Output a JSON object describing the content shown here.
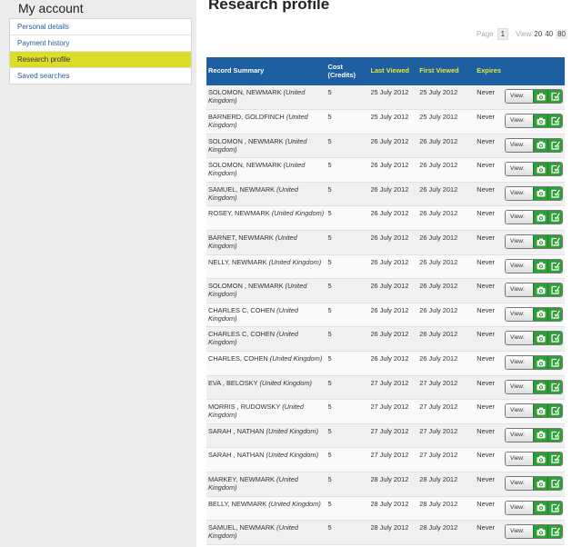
{
  "sidebar": {
    "title": "My account",
    "items": [
      {
        "label": "Personal details",
        "active": false
      },
      {
        "label": "Payment history",
        "active": false
      },
      {
        "label": "Research profile",
        "active": true
      },
      {
        "label": "Saved searches",
        "active": false
      }
    ]
  },
  "main": {
    "title": "Research profile",
    "pager": {
      "page_label": "Page",
      "page": "1",
      "view_label": "View",
      "sizes": [
        "20",
        "40",
        "80"
      ],
      "current_size": "80"
    },
    "columns": {
      "record": "Record Summary",
      "cost": "Cost (Credits)",
      "last_viewed": "Last Viewed",
      "first_viewed": "First Viewed",
      "expires": "Expires"
    },
    "view_label": "View:",
    "rows": [
      {
        "name": "SOLOMON, NEWMARK",
        "place": "(United Kingdom)",
        "cost": "5",
        "last": "25 July 2012",
        "first": "25 July 2012",
        "expires": "Never"
      },
      {
        "name": "BARNERD, GOLDFINCH",
        "place": "(United Kingdom)",
        "cost": "5",
        "last": "25 July 2012",
        "first": "25 July 2012",
        "expires": "Never"
      },
      {
        "name": "SOLOMON , NEWMARK",
        "place": "(United Kingdom)",
        "cost": "5",
        "last": "26 July 2012",
        "first": "26 July 2012",
        "expires": "Never"
      },
      {
        "name": "SOLOMON, NEWMARK",
        "place": "(United Kingdom)",
        "cost": "5",
        "last": "26 July 2012",
        "first": "26 July 2012",
        "expires": "Never"
      },
      {
        "name": "SAMUEL, NEWMARK",
        "place": "(United Kingdom)",
        "cost": "5",
        "last": "26 July 2012",
        "first": "26 July 2012",
        "expires": "Never"
      },
      {
        "name": "ROSEY, NEWMARK",
        "place": "(United Kingdom)",
        "cost": "5",
        "last": "26 July 2012",
        "first": "26 July 2012",
        "expires": "Never"
      },
      {
        "name": "BARNET, NEWMARK",
        "place": "(United Kingdom)",
        "cost": "5",
        "last": "26 July 2012",
        "first": "26 July 2012",
        "expires": "Never"
      },
      {
        "name": "NELLY, NEWMARK",
        "place": "(United Kingdom)",
        "cost": "5",
        "last": "26 July 2012",
        "first": "26 July 2012",
        "expires": "Never"
      },
      {
        "name": "SOLOMON , NEWMARK",
        "place": "(United Kingdom)",
        "cost": "5",
        "last": "26 July 2012",
        "first": "26 July 2012",
        "expires": "Never"
      },
      {
        "name": "CHARLES C, COHEN",
        "place": "(United Kingdom)",
        "cost": "5",
        "last": "26 July 2012",
        "first": "26 July 2012",
        "expires": "Never"
      },
      {
        "name": "CHARLES C, COHEN",
        "place": "(United Kingdom)",
        "cost": "5",
        "last": "26 July 2012",
        "first": "26 July 2012",
        "expires": "Never"
      },
      {
        "name": "CHARLES, COHEN",
        "place": "(United Kingdom)",
        "cost": "5",
        "last": "26 July 2012",
        "first": "26 July 2012",
        "expires": "Never"
      },
      {
        "name": "EVA , BELOSKY",
        "place": "(United Kingdom)",
        "cost": "5",
        "last": "27 July 2012",
        "first": "27 July 2012",
        "expires": "Never"
      },
      {
        "name": "MORRIS , RUDOWSKY",
        "place": "(United Kingdom)",
        "cost": "5",
        "last": "27 July 2012",
        "first": "27 July 2012",
        "expires": "Never"
      },
      {
        "name": "SARAH , NATHAN",
        "place": "(United Kingdom)",
        "cost": "5",
        "last": "27 July 2012",
        "first": "27 July 2012",
        "expires": "Never"
      },
      {
        "name": "SARAH , NATHAN",
        "place": "(United Kingdom)",
        "cost": "5",
        "last": "27 July 2012",
        "first": "27 July 2012",
        "expires": "Never"
      },
      {
        "name": "MARKEY, NEWMARK",
        "place": "(United Kingdom)",
        "cost": "5",
        "last": "28 July 2012",
        "first": "28 July 2012",
        "expires": "Never"
      },
      {
        "name": "BELLY, NEWMARK",
        "place": "(United Kingdom)",
        "cost": "5",
        "last": "28 July 2012",
        "first": "28 July 2012",
        "expires": "Never"
      },
      {
        "name": "SAMUEL, NEWMARK",
        "place": "(United Kingdom)",
        "cost": "5",
        "last": "28 July 2012",
        "first": "28 July 2012",
        "expires": "Never"
      }
    ]
  },
  "icons": {
    "camera": "camera-icon",
    "notes": "notes-check-icon"
  },
  "colors": {
    "header": "#1d5fa0",
    "header_highlight": "#e6e63a",
    "active_menu": "#dcdc2a",
    "action_green": "#2e9e37"
  }
}
